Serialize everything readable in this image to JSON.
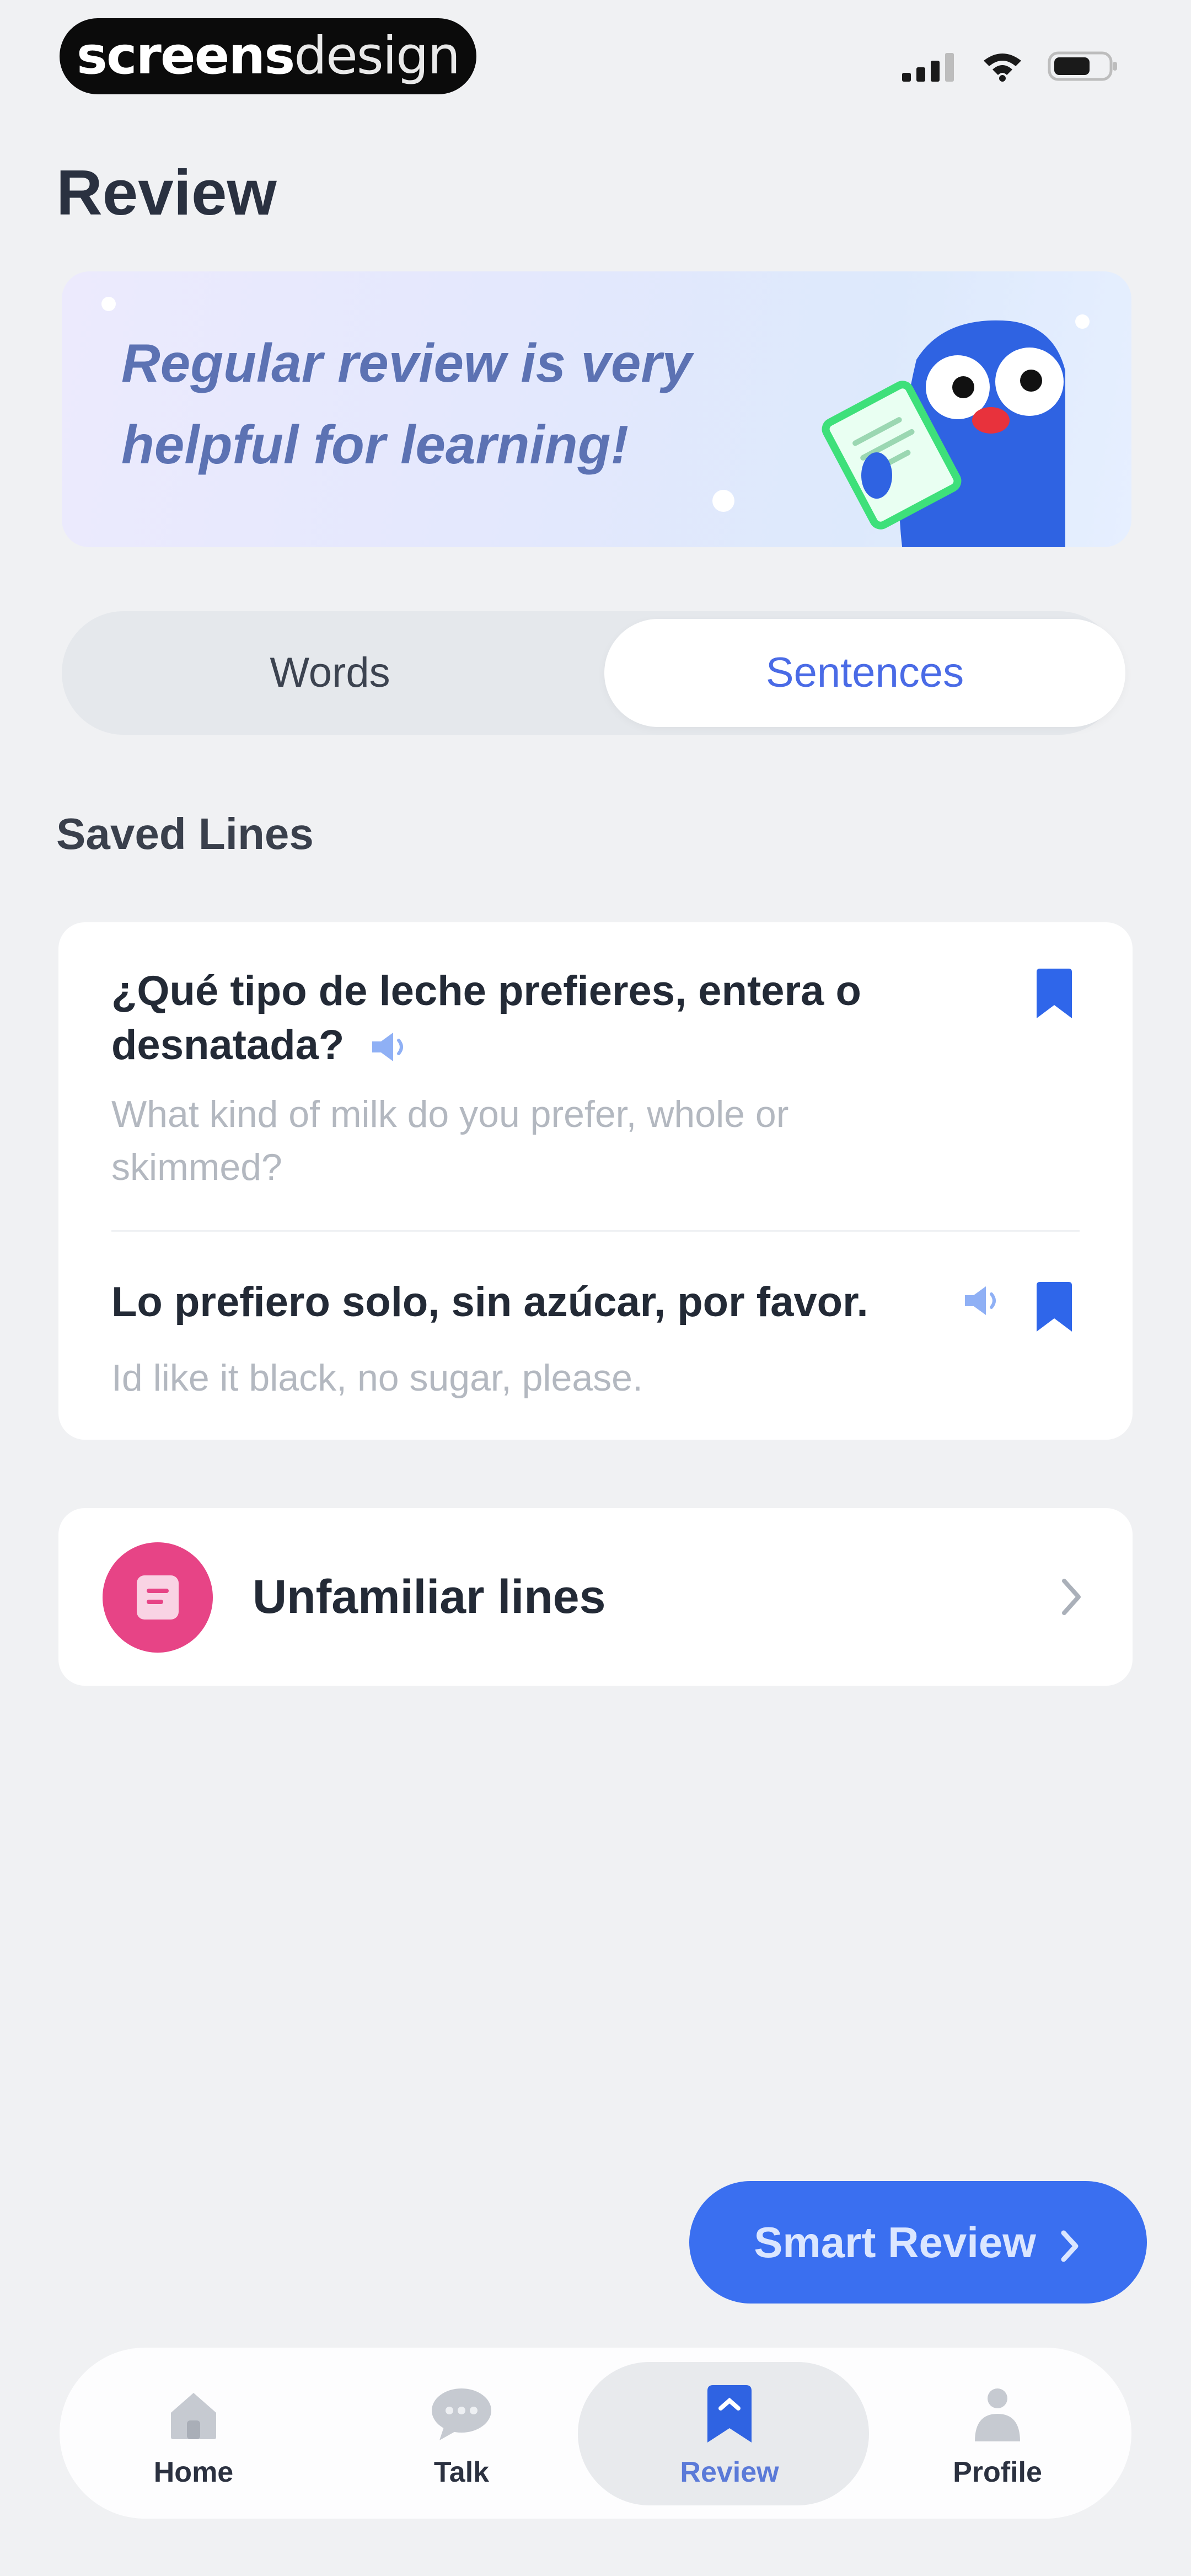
{
  "status_bar": {
    "brand_bold": "screens",
    "brand_light": "design"
  },
  "page": {
    "title": "Review"
  },
  "banner": {
    "text": "Regular review is very helpful for learning!"
  },
  "segmented": {
    "options": [
      "Words",
      "Sentences"
    ],
    "selected": "Sentences"
  },
  "saved": {
    "title": "Saved Lines",
    "items": [
      {
        "spanish": "¿Qué tipo de leche prefieres, entera o desnatada?",
        "english": "What kind of milk do you prefer, whole or skimmed?"
      },
      {
        "spanish": "Lo prefiero solo, sin azúcar, por favor.",
        "english": "Id like it black, no sugar, please."
      }
    ]
  },
  "unfamiliar": {
    "label": "Unfamiliar lines"
  },
  "smart_review": {
    "label": "Smart Review"
  },
  "tabbar": {
    "items": [
      {
        "label": "Home",
        "icon": "home-icon"
      },
      {
        "label": "Talk",
        "icon": "chat-icon"
      },
      {
        "label": "Review",
        "icon": "bookmark-icon"
      },
      {
        "label": "Profile",
        "icon": "person-icon"
      }
    ],
    "active": "Review"
  },
  "colors": {
    "accent": "#3a6ff0",
    "pink": "#e74486",
    "background": "#f0f1f3"
  }
}
